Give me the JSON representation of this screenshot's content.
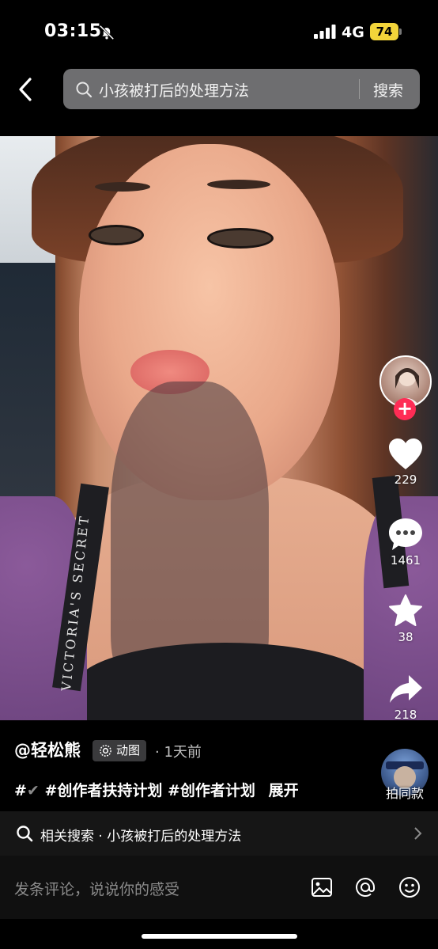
{
  "status_bar": {
    "time": "03:15",
    "network": "4G",
    "battery": "74",
    "battery_color": "#f2d43a"
  },
  "search": {
    "query": "小孩被打后的处理方法",
    "submit_label": "搜索"
  },
  "video": {
    "strap_text": "VICTORIA'S SECRET"
  },
  "actions": {
    "likes": "229",
    "comments": "1461",
    "favorites": "38",
    "shares": "218",
    "follow_color": "#fe2c55"
  },
  "post": {
    "author": "@轻松熊",
    "tag": "动图",
    "time_ago": "· 1天前",
    "caption_prefix": "#",
    "caption_check": "✔",
    "caption": "#创作者扶持计划 #创作者计划",
    "expand": "展开",
    "remix_label": "拍同款"
  },
  "related": {
    "text": "相关搜索 · 小孩被打后的处理方法"
  },
  "comment_bar": {
    "placeholder": "发条评论，说说你的感受"
  }
}
